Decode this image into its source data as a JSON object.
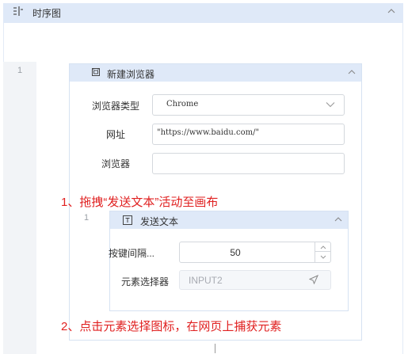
{
  "outer": {
    "title": "时序图"
  },
  "gutter": {
    "line_number": "1"
  },
  "new_browser": {
    "title": "新建浏览器",
    "browser_type_label": "浏览器类型",
    "browser_type_value": "Chrome",
    "url_label": "网址",
    "url_value": "\"https://www.baidu.com/\"",
    "browser_label": "浏览器",
    "browser_value": ""
  },
  "annotations": {
    "step1": "1、拖拽“发送文本”活动至画布",
    "step2": "2、点击元素选择图标，在网页上捕获元素"
  },
  "send_text": {
    "line_number": "1",
    "title": "发送文本",
    "interval_label": "按键间隔...",
    "interval_value": "50",
    "selector_label": "元素选择器",
    "selector_value": "INPUT2"
  },
  "colors": {
    "header_bg": "#dfe9f8",
    "annotation": "#e02020"
  },
  "icons": {
    "outer_title": "sequence-diagram-icon",
    "card1": "browser-icon",
    "card2": "text-t-icon",
    "selector": "cursor-arrow-icon"
  }
}
